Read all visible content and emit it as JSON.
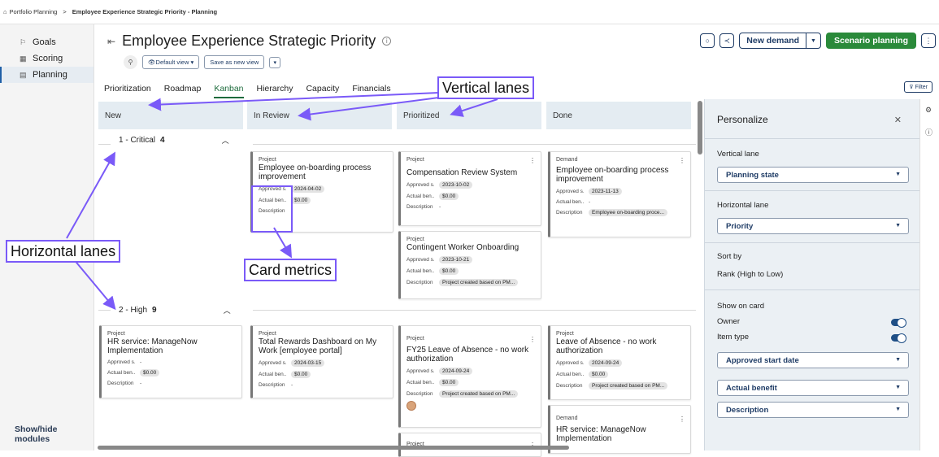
{
  "breadcrumb": {
    "icon": "portfolio-icon",
    "root": "Portfolio Planning",
    "separator": ">",
    "current": "Employee Experience Strategic Priority - Planning"
  },
  "sidebar": {
    "items": [
      {
        "icon": "flag-icon",
        "label": "Goals"
      },
      {
        "icon": "scoring-icon",
        "label": "Scoring"
      },
      {
        "icon": "planning-icon",
        "label": "Planning"
      }
    ],
    "footer": "Show/hide modules"
  },
  "header": {
    "title": "Employee Experience Strategic Priority",
    "view_label": "Default view",
    "save_view": "Save as new view",
    "new_demand": "New demand",
    "scenario": "Scenario planning",
    "filter": "Filter"
  },
  "tabs": [
    "Prioritization",
    "Roadmap",
    "Kanban",
    "Hierarchy",
    "Capacity",
    "Financials"
  ],
  "active_tab": "Kanban",
  "columns": [
    "New",
    "In Review",
    "Prioritized",
    "Done"
  ],
  "lanes": [
    {
      "name": "1 - Critical",
      "count": "4"
    },
    {
      "name": "2 - High",
      "count": "9"
    }
  ],
  "field_labels": {
    "approved": "Approved s...",
    "actual": "Actual ben...",
    "description": "Description"
  },
  "cards": {
    "c1": {
      "type": "Project",
      "name": "Employee on-boarding process improvement",
      "approved": "2024-04-02",
      "actual": "$0.00",
      "description": "-"
    },
    "c2": {
      "type": "Project",
      "name": "Compensation Review System",
      "approved": "2023-10-02",
      "actual": "$0.00",
      "description": "-"
    },
    "c3": {
      "type": "Project",
      "name": "Contingent Worker Onboarding",
      "approved": "2023-10-21",
      "actual": "$0.00",
      "description": "Project created based on PM..."
    },
    "c4": {
      "type": "Demand",
      "name": "Employee on-boarding process improvement",
      "approved": "2023-11-13",
      "actual": "-",
      "description": "Employee on-boarding proce..."
    },
    "c5": {
      "type": "Project",
      "name": "HR service: ManageNow Implementation",
      "approved": "-",
      "actual": "$0.00",
      "description": "-"
    },
    "c6": {
      "type": "Project",
      "name": "Total Rewards Dashboard on My Work [employee portal]",
      "approved": "2024-03-15",
      "actual": "$0.00",
      "description": "-"
    },
    "c7": {
      "type": "Project",
      "name": "FY25 Leave of Absence - no work authorization",
      "approved": "2024-09-24",
      "actual": "$0.00",
      "description": "Project created based on PM..."
    },
    "c8": {
      "type": "Project",
      "name": "Leave of Absence - no work authorization",
      "approved": "2024-09-24",
      "actual": "$0.00",
      "description": "Project created based on PM..."
    },
    "c9": {
      "type": "Demand",
      "name": "HR service: ManageNow Implementation"
    },
    "c10": {
      "type": "Project"
    }
  },
  "panel": {
    "title": "Personalize",
    "vertical_lane_label": "Vertical lane",
    "vertical_lane_value": "Planning state",
    "horizontal_lane_label": "Horizontal lane",
    "horizontal_lane_value": "Priority",
    "sort_label": "Sort by",
    "sort_value": "Rank (High to Low)",
    "show_on_card": "Show on card",
    "owner": "Owner",
    "owner_on": true,
    "item_type": "Item type",
    "item_type_on": true,
    "fields": [
      "Approved start date",
      "Actual benefit",
      "Description"
    ]
  },
  "annotations": {
    "vertical": "Vertical lanes",
    "horizontal": "Horizontal lanes",
    "metrics": "Card metrics"
  },
  "colors": {
    "accent": "#7a5af8",
    "primary": "#1f3c66",
    "green": "#2a8a3a"
  }
}
